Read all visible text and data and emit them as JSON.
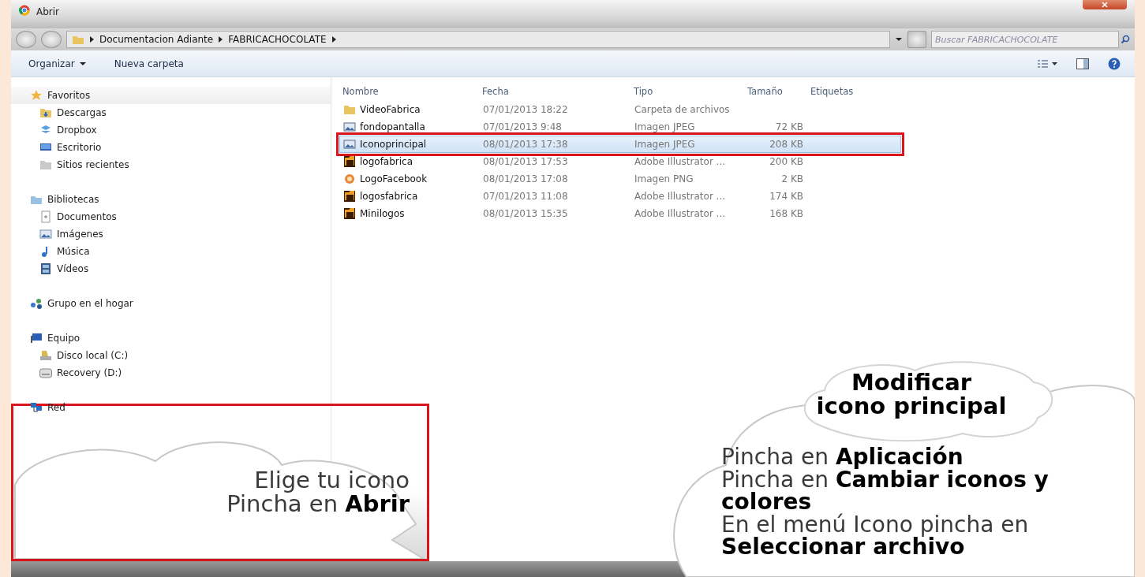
{
  "window": {
    "title": "Abrir"
  },
  "address": {
    "breadcrumbs": [
      "Documentacion Adiante",
      "FABRICACHOCOLATE"
    ]
  },
  "search": {
    "placeholder": "Buscar FABRICACHOCOLATE"
  },
  "toolbar": {
    "organize": "Organizar",
    "new_folder": "Nueva carpeta"
  },
  "sidebar": {
    "groups": [
      {
        "label": "Favoritos",
        "kind": "star",
        "selected": true,
        "children": [
          {
            "label": "Descargas",
            "kind": "downloads",
            "selected": false
          },
          {
            "label": "Dropbox",
            "kind": "dropbox",
            "selected": false
          },
          {
            "label": "Escritorio",
            "kind": "desktop",
            "selected": false
          },
          {
            "label": "Sitios recientes",
            "kind": "recent",
            "selected": false
          }
        ]
      },
      {
        "label": "Bibliotecas",
        "kind": "library",
        "selected": false,
        "children": [
          {
            "label": "Documentos",
            "kind": "documents",
            "selected": false
          },
          {
            "label": "Imágenes",
            "kind": "pictures",
            "selected": false
          },
          {
            "label": "Música",
            "kind": "music",
            "selected": false
          },
          {
            "label": "Vídeos",
            "kind": "videos",
            "selected": false
          }
        ]
      },
      {
        "label": "Grupo en el hogar",
        "kind": "homegroup",
        "selected": false
      },
      {
        "label": "Equipo",
        "kind": "computer",
        "selected": false,
        "children": [
          {
            "label": "Disco local (C:)",
            "kind": "disk",
            "selected": false
          },
          {
            "label": "Recovery (D:)",
            "kind": "drive",
            "selected": false
          }
        ]
      },
      {
        "label": "Red",
        "kind": "network",
        "selected": false
      }
    ]
  },
  "table": {
    "columns": [
      "Nombre",
      "Fecha",
      "Tipo",
      "Tamaño",
      "Etiquetas"
    ],
    "rows": [
      {
        "name": "VideoFabrica",
        "date": "07/01/2013 18:22",
        "type": "Carpeta de archivos",
        "kind": "folder",
        "selected": false,
        "outlined": false
      },
      {
        "name": "fondopantalla",
        "date": "07/01/2013 9:48",
        "type": "Imagen JPEG",
        "size": "72 KB",
        "kind": "image",
        "selected": false,
        "outlined": false
      },
      {
        "name": "Iconoprincipal",
        "date": "08/01/2013 17:38",
        "type": "Imagen JPEG",
        "size": "208 KB",
        "kind": "image",
        "selected": true,
        "outlined": true
      },
      {
        "name": "logofabrica",
        "date": "08/01/2013 17:53",
        "type": "Adobe Illustrator ...",
        "size": "200 KB",
        "kind": "illustrator",
        "selected": false,
        "outlined": false
      },
      {
        "name": "LogoFacebook",
        "date": "08/01/2013 17:08",
        "type": "Imagen PNG",
        "size": "2 KB",
        "kind": "png",
        "selected": false,
        "outlined": false
      },
      {
        "name": "logosfabrica",
        "date": "07/01/2013 11:08",
        "type": "Adobe Illustrator ...",
        "size": "174 KB",
        "kind": "illustrator",
        "selected": false,
        "outlined": false
      },
      {
        "name": "Minilogos",
        "date": "08/01/2013 15:35",
        "type": "Adobe Illustrator ...",
        "size": "168 KB",
        "kind": "illustrator",
        "selected": false,
        "outlined": false
      }
    ]
  },
  "callouts": [
    {
      "kind": "framed",
      "lines": [
        "Elige tu icono",
        "Pincha en **Abrir**"
      ]
    },
    {
      "kind": "cloud",
      "title": [
        "Modificar",
        "icono principal"
      ],
      "lines": [
        "Pincha en **Aplicación**",
        "Pincha en **Cambiar iconos y colores**",
        "En el menú Icono pincha en **Seleccionar archivo**"
      ]
    }
  ]
}
